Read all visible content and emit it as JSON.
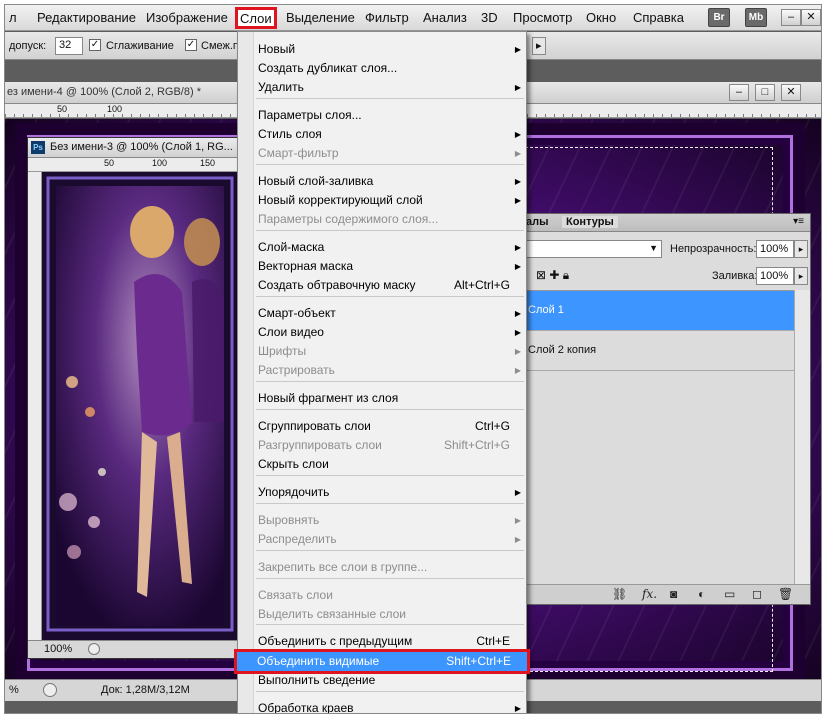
{
  "menubar": {
    "items": [
      "л",
      "Редактирование",
      "Изображение",
      "Слои",
      "Выделение",
      "Фильтр",
      "Анализ",
      "3D",
      "Просмотр",
      "Окно",
      "Справка"
    ],
    "badges": [
      "Br",
      "Mb"
    ],
    "window_controls": [
      "–",
      "□",
      "✕"
    ]
  },
  "options": {
    "tolerance_label": "допуск:",
    "tolerance_value": "32",
    "antialias_label": "Сглаживание",
    "contiguous_label": "Смеж.п"
  },
  "doc4": {
    "title": "ез имени-4 @ 100% (Слой 2, RGB/8) *",
    "ruler_marks": [
      "50",
      "100"
    ],
    "controls": [
      "–",
      "□",
      "✕"
    ]
  },
  "doc3": {
    "title": "Без имени-3 @ 100% (Слой 1, RG...",
    "ruler_marks": [
      "50",
      "100",
      "150"
    ],
    "zoom": "100%"
  },
  "panel": {
    "tabs": [
      "алы",
      "Контуры"
    ],
    "opacity_label": "Непрозрачность:",
    "opacity_value": "100%",
    "fill_label": "Заливка:",
    "fill_value": "100%",
    "layers": [
      {
        "name": "Слой 1",
        "selected": true
      },
      {
        "name": "Слой 2 копия",
        "selected": false
      }
    ]
  },
  "status": {
    "zoom": "%",
    "doc_info": "Док: 1,28M/3,12M"
  },
  "menu": {
    "items": [
      {
        "label": "Новый",
        "shortcut": "",
        "submenu": true,
        "disabled": false
      },
      {
        "label": "Создать дубликат слоя...",
        "shortcut": "",
        "submenu": false,
        "disabled": false
      },
      {
        "label": "Удалить",
        "shortcut": "",
        "submenu": true,
        "disabled": false
      },
      {
        "label": "Параметры слоя...",
        "shortcut": "",
        "submenu": false,
        "disabled": false
      },
      {
        "label": "Стиль слоя",
        "shortcut": "",
        "submenu": true,
        "disabled": false
      },
      {
        "label": "Смарт-фильтр",
        "shortcut": "",
        "submenu": true,
        "disabled": true
      },
      {
        "label": "Новый слой-заливка",
        "shortcut": "",
        "submenu": true,
        "disabled": false
      },
      {
        "label": "Новый корректирующий слой",
        "shortcut": "",
        "submenu": true,
        "disabled": false
      },
      {
        "label": "Параметры содержимого слоя...",
        "shortcut": "",
        "submenu": false,
        "disabled": true
      },
      {
        "label": "Слой-маска",
        "shortcut": "",
        "submenu": true,
        "disabled": false
      },
      {
        "label": "Векторная маска",
        "shortcut": "",
        "submenu": true,
        "disabled": false
      },
      {
        "label": "Создать обтравочную маску",
        "shortcut": "Alt+Ctrl+G",
        "submenu": false,
        "disabled": false
      },
      {
        "label": "Смарт-объект",
        "shortcut": "",
        "submenu": true,
        "disabled": false
      },
      {
        "label": "Слои видео",
        "shortcut": "",
        "submenu": true,
        "disabled": false
      },
      {
        "label": "Шрифты",
        "shortcut": "",
        "submenu": true,
        "disabled": true
      },
      {
        "label": "Растрировать",
        "shortcut": "",
        "submenu": true,
        "disabled": true
      },
      {
        "label": "Новый фрагмент из слоя",
        "shortcut": "",
        "submenu": false,
        "disabled": false
      },
      {
        "label": "Сгруппировать слои",
        "shortcut": "Ctrl+G",
        "submenu": false,
        "disabled": false
      },
      {
        "label": "Разгруппировать слои",
        "shortcut": "Shift+Ctrl+G",
        "submenu": false,
        "disabled": true
      },
      {
        "label": "Скрыть слои",
        "shortcut": "",
        "submenu": false,
        "disabled": false
      },
      {
        "label": "Упорядочить",
        "shortcut": "",
        "submenu": true,
        "disabled": false
      },
      {
        "label": "Выровнять",
        "shortcut": "",
        "submenu": true,
        "disabled": true
      },
      {
        "label": "Распределить",
        "shortcut": "",
        "submenu": true,
        "disabled": true
      },
      {
        "label": "Закрепить все слои в группе...",
        "shortcut": "",
        "submenu": false,
        "disabled": true
      },
      {
        "label": "Связать слои",
        "shortcut": "",
        "submenu": false,
        "disabled": true
      },
      {
        "label": "Выделить связанные слои",
        "shortcut": "",
        "submenu": false,
        "disabled": true
      },
      {
        "label": "Объединить с предыдущим",
        "shortcut": "Ctrl+E",
        "submenu": false,
        "disabled": false
      },
      {
        "label": "Объединить видимые",
        "shortcut": "Shift+Ctrl+E",
        "submenu": false,
        "disabled": false,
        "highlighted": true
      },
      {
        "label": "Выполнить сведение",
        "shortcut": "",
        "submenu": false,
        "disabled": false
      },
      {
        "label": "Обработка краев",
        "shortcut": "",
        "submenu": true,
        "disabled": false
      }
    ]
  },
  "colors": {
    "highlight": "#3d95ff",
    "annotation_red": "#e0141e",
    "canvas_purple": "#5a1a8a"
  }
}
